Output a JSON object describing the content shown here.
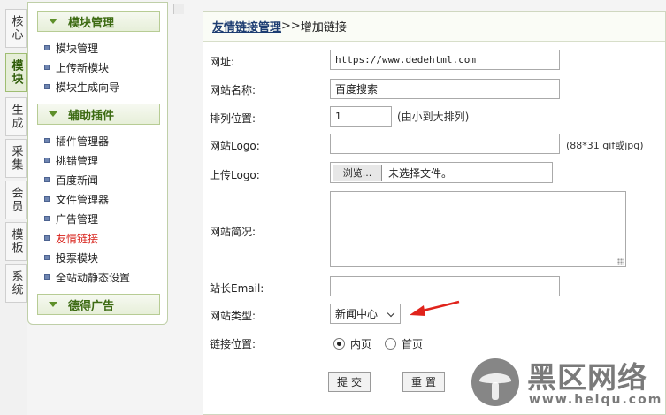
{
  "tabs": [
    {
      "label": "核心",
      "active": false
    },
    {
      "label": "模块",
      "active": true
    },
    {
      "label": "生成",
      "active": false
    },
    {
      "label": "采集",
      "active": false
    },
    {
      "label": "会员",
      "active": false
    },
    {
      "label": "模板",
      "active": false
    },
    {
      "label": "系统",
      "active": false
    }
  ],
  "sidebar": {
    "groups": [
      {
        "title": "模块管理",
        "items": [
          "模块管理",
          "上传新模块",
          "模块生成向导"
        ]
      },
      {
        "title": "辅助插件",
        "items": [
          "插件管理器",
          "挑错管理",
          "百度新闻",
          "文件管理器",
          "广告管理",
          "友情链接",
          "投票模块",
          "全站动静态设置"
        ]
      },
      {
        "title": "德得广告",
        "items": []
      }
    ],
    "current_item": "友情链接"
  },
  "header": {
    "crumb_link": "友情链接管理",
    "crumb_sep": ">>",
    "crumb_current": "增加链接"
  },
  "form": {
    "url_label": "网址:",
    "url_value": "https://www.dedehtml.com",
    "name_label": "网站名称:",
    "name_value": "百度搜索",
    "order_label": "排列位置:",
    "order_value": "1",
    "order_hint": "(由小到大排列)",
    "logo_label": "网站Logo:",
    "logo_value": "",
    "logo_hint": "(88*31 gif或jpg)",
    "upload_label": "上传Logo:",
    "browse_label": "浏览...",
    "file_status": "未选择文件。",
    "desc_label": "网站简况:",
    "email_label": "站长Email:",
    "email_value": "",
    "type_label": "网站类型:",
    "type_selected": "新闻中心",
    "position_label": "链接位置:",
    "position_options": [
      "内页",
      "首页"
    ],
    "position_selected": "内页",
    "submit_label": "提交",
    "reset_label": "重置"
  },
  "annotation": {
    "arrow_color": "#e0231b"
  },
  "watermark": {
    "brand": "黑区网络",
    "url": "www.heiqu.com"
  },
  "colors": {
    "accent_green": "#3d6b13",
    "current_red": "#d8221b",
    "link_blue": "#1d3d72"
  }
}
